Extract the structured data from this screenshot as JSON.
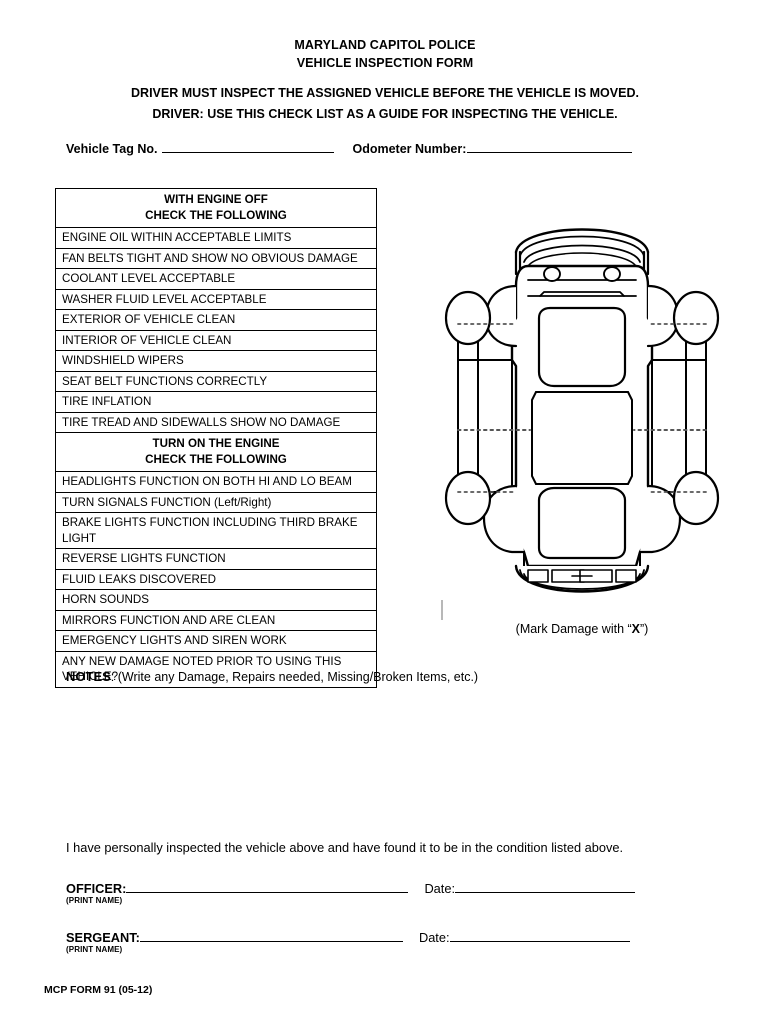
{
  "header": {
    "org_line": "MARYLAND CAPITOL POLICE",
    "form_line": "VEHICLE INSPECTION FORM",
    "instruction_1": "DRIVER MUST INSPECT THE ASSIGNED VEHICLE BEFORE THE VEHICLE IS MOVED.",
    "instruction_2": "DRIVER: USE THIS CHECK LIST AS A GUIDE FOR INSPECTING THE VEHICLE."
  },
  "identifiers": {
    "vehicle_tag_label": "Vehicle Tag No.",
    "vehicle_tag_value": "",
    "odometer_label": "Odometer Number:",
    "odometer_value": ""
  },
  "checklist": {
    "sections": [
      {
        "title_line1": "WITH ENGINE OFF",
        "title_line2": "CHECK THE FOLLOWING",
        "items": [
          "ENGINE OIL WITHIN ACCEPTABLE LIMITS",
          "FAN BELTS TIGHT AND SHOW NO OBVIOUS DAMAGE",
          "COOLANT LEVEL ACCEPTABLE",
          "WASHER FLUID LEVEL ACCEPTABLE",
          "EXTERIOR OF VEHICLE CLEAN",
          "INTERIOR OF VEHICLE CLEAN",
          "WINDSHIELD WIPERS",
          "SEAT BELT FUNCTIONS CORRECTLY",
          "TIRE INFLATION",
          "TIRE TREAD AND SIDEWALLS SHOW NO DAMAGE"
        ]
      },
      {
        "title_line1": "TURN ON THE ENGINE",
        "title_line2": "CHECK THE FOLLOWING",
        "items": [
          "HEADLIGHTS FUNCTION ON BOTH HI AND LO BEAM",
          "TURN SIGNALS FUNCTION (Left/Right)",
          "BRAKE LIGHTS FUNCTION INCLUDING THIRD BRAKE LIGHT",
          "REVERSE LIGHTS FUNCTION",
          "FLUID LEAKS DISCOVERED",
          "HORN SOUNDS",
          "MIRRORS FUNCTION AND ARE CLEAN",
          "EMERGENCY LIGHTS AND SIREN WORK",
          "ANY NEW DAMAGE NOTED PRIOR TO USING THIS VEHICLE?"
        ]
      }
    ]
  },
  "diagram": {
    "caption_prefix": "(Mark Damage with “",
    "caption_mark": "X",
    "caption_suffix": "”)",
    "view": "car-top-view",
    "line_color": "#000000"
  },
  "notes": {
    "label": "NOTES",
    "hint": ": (Write any Damage, Repairs needed, Missing/Broken Items, etc.)",
    "value": ""
  },
  "attestation": {
    "statement": "I have personally inspected the vehicle above and have found it to be in the condition listed above."
  },
  "signatures": {
    "officer": {
      "role_label": "OFFICER:",
      "name_value": "",
      "date_label": "Date:",
      "date_value": "",
      "print_hint": "(PRINT NAME)"
    },
    "sergeant": {
      "role_label": "SERGEANT:",
      "name_value": "",
      "date_label": "Date:",
      "date_value": "",
      "print_hint": "(PRINT NAME)"
    }
  },
  "footer": {
    "form_number": "MCP FORM 91 (05-12)"
  }
}
